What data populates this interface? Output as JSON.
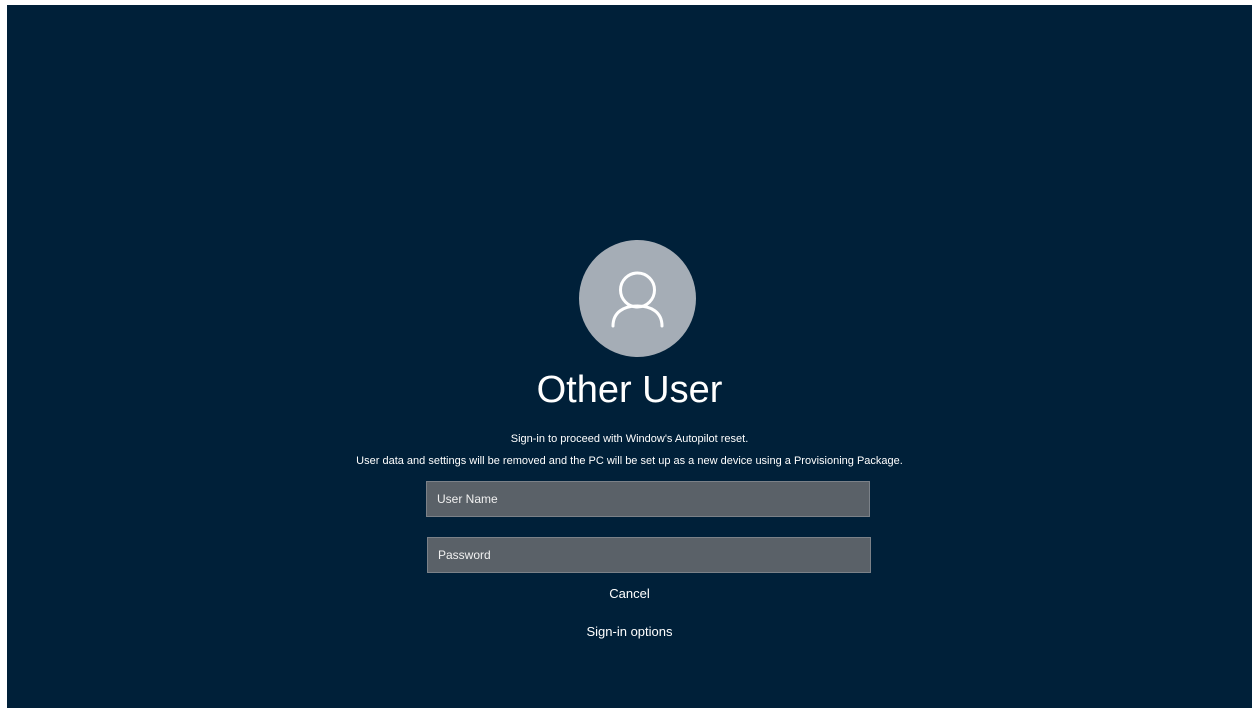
{
  "user": {
    "display_name": "Other User",
    "avatar_icon": "person-icon"
  },
  "message": {
    "line1": "Sign-in to proceed with Window's Autopilot reset.",
    "line2": "User data and settings will be removed and the PC will be set up as a new device using a Provisioning Package."
  },
  "form": {
    "username_placeholder": "User Name",
    "username_value": "",
    "password_placeholder": "Password",
    "password_value": ""
  },
  "actions": {
    "cancel_label": "Cancel",
    "signin_options_label": "Sign-in options"
  },
  "colors": {
    "background": "#002039",
    "avatar": "#a5adb6",
    "field": "#5a6168"
  }
}
